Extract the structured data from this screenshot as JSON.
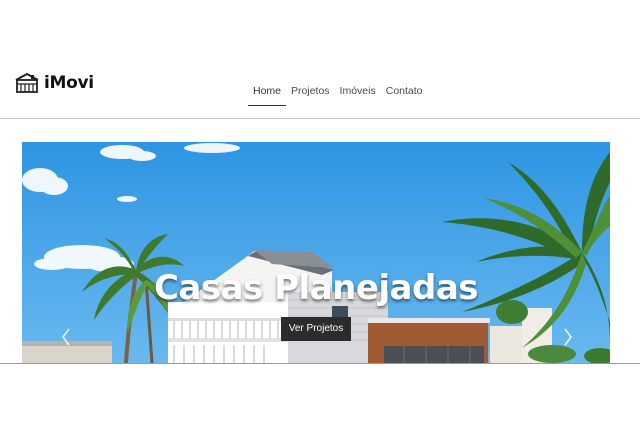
{
  "brand": {
    "name": "iMovi",
    "logo_icon": "house-icon"
  },
  "nav": {
    "items": [
      {
        "label": "Home",
        "active": true
      },
      {
        "label": "Projetos",
        "active": false
      },
      {
        "label": "Imóveis",
        "active": false
      },
      {
        "label": "Contato",
        "active": false
      }
    ]
  },
  "hero": {
    "title": "Casas Planejadas",
    "button_label": "Ver Projetos",
    "prev_icon": "chevron-left-icon",
    "next_icon": "chevron-right-icon"
  },
  "colors": {
    "sky": "#3aa0e6",
    "button": "#2c2c2c",
    "text": "#111111"
  }
}
